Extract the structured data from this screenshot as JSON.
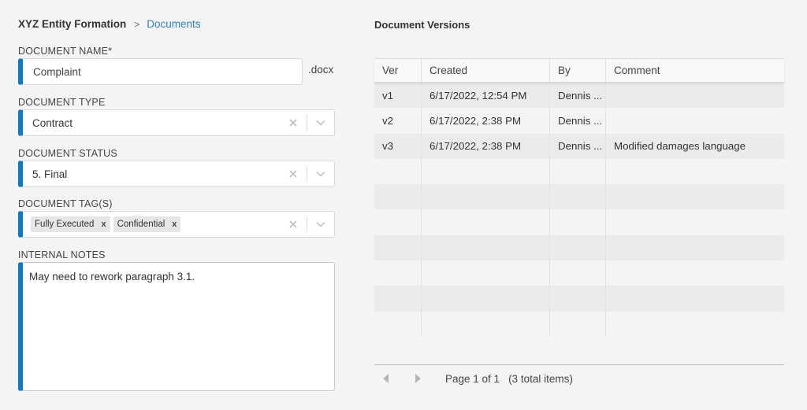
{
  "breadcrumb": {
    "root": "XYZ Entity Formation",
    "separator": ">",
    "current": "Documents"
  },
  "form": {
    "name": {
      "label": "DOCUMENT NAME*",
      "value": "Complaint",
      "extension": ".docx"
    },
    "type": {
      "label": "DOCUMENT TYPE",
      "value": "Contract"
    },
    "status": {
      "label": "DOCUMENT STATUS",
      "value": "5. Final"
    },
    "tags": {
      "label": "DOCUMENT TAG(S)",
      "items": [
        {
          "label": "Fully Executed",
          "remove": "x"
        },
        {
          "label": "Confidential",
          "remove": "x"
        }
      ]
    },
    "notes": {
      "label": "INTERNAL NOTES",
      "value": "May need to rework paragraph 3.1."
    },
    "accent_color": "#1177c7"
  },
  "versions": {
    "title": "Document Versions",
    "columns": [
      "Ver",
      "Created",
      "By",
      "Comment"
    ],
    "rows": [
      [
        "v1",
        "6/17/2022, 12:54 PM",
        "Dennis ...",
        ""
      ],
      [
        "v2",
        "6/17/2022, 2:38 PM",
        "Dennis ...",
        ""
      ],
      [
        "v3",
        "6/17/2022, 2:38 PM",
        "Dennis ...",
        "Modified damages language"
      ]
    ],
    "pager": {
      "page": "Page 1 of 1",
      "total": "(3 total items)"
    }
  }
}
